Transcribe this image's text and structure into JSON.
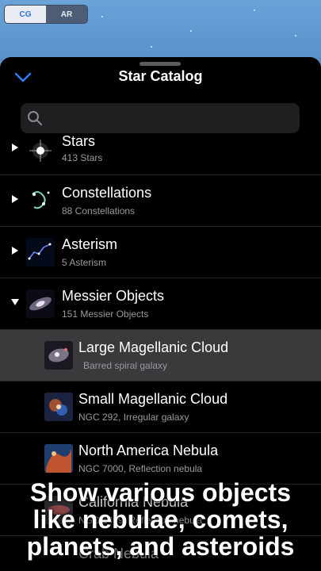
{
  "mode_toggle": {
    "options": [
      "CG",
      "AR"
    ],
    "selected": "CG"
  },
  "sheet": {
    "title": "Star Catalog"
  },
  "search": {
    "placeholder": ""
  },
  "catalog": [
    {
      "title": "Stars",
      "subtitle": "413 Stars",
      "expanded": false,
      "icon": "star-thumbnail"
    },
    {
      "title": "Constellations",
      "subtitle": "88 Constellations",
      "expanded": false,
      "icon": "constellation-thumbnail"
    },
    {
      "title": "Asterism",
      "subtitle": "5 Asterism",
      "expanded": false,
      "icon": "asterism-thumbnail"
    },
    {
      "title": "Messier Objects",
      "subtitle": "151 Messier Objects",
      "expanded": true,
      "icon": "galaxy-thumbnail"
    }
  ],
  "messier_items": [
    {
      "title": "Large Magellanic Cloud",
      "subtitle": "Barred spiral galaxy",
      "selected": true
    },
    {
      "title": "Small Magellanic Cloud",
      "subtitle": "NGC 292,   Irregular galaxy"
    },
    {
      "title": "North America Nebula",
      "subtitle": "NGC 7000,   Reflection nebula"
    },
    {
      "title": "California Nebula",
      "subtitle": "NGC 1499,   Reflection nebula"
    },
    {
      "title": "Crab Nebula",
      "subtitle": ""
    }
  ],
  "caption": {
    "line1": "Show various objects",
    "line2": "like nebulae, comets,",
    "line3": "planets, and asteroids"
  },
  "colors": {
    "sheet_background": "#000000",
    "accent": "#2f7cf6",
    "selected_row": "#3a3a3c",
    "sky": "#5b93cc"
  }
}
